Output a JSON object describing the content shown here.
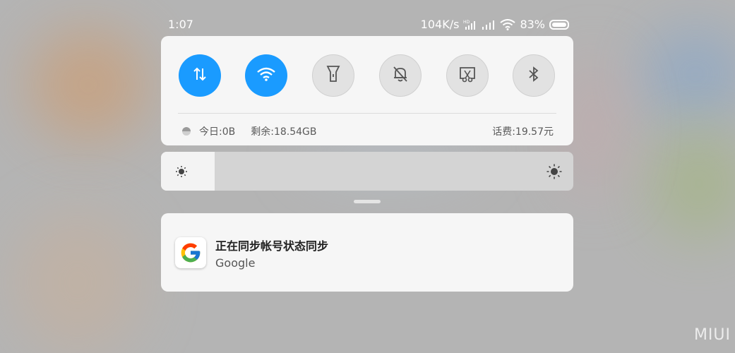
{
  "status_bar": {
    "time": "1:07",
    "speed": "104K/s",
    "battery": "83%"
  },
  "quick_toggles": [
    {
      "name": "mobile-data",
      "icon": "data-arrows-icon",
      "state": "on"
    },
    {
      "name": "wifi",
      "icon": "wifi-icon",
      "state": "on"
    },
    {
      "name": "flashlight",
      "icon": "flashlight-icon",
      "state": "off"
    },
    {
      "name": "silent",
      "icon": "bell-off-icon",
      "state": "off"
    },
    {
      "name": "screenshot",
      "icon": "scissors-screenshot-icon",
      "state": "off"
    },
    {
      "name": "bluetooth",
      "icon": "bluetooth-icon",
      "state": "off"
    }
  ],
  "data_usage": {
    "today": "今日:0B",
    "remaining": "剩余:18.54GB",
    "balance": "话费:19.57元"
  },
  "brightness": {
    "level": 0.13
  },
  "notification": {
    "title": "正在同步帐号状态同步",
    "app": "Google"
  },
  "watermark": "MIUI",
  "colors": {
    "accent": "#1a9bff",
    "panel": "#f6f6f6",
    "toggle_off": "#e2e2e2"
  }
}
